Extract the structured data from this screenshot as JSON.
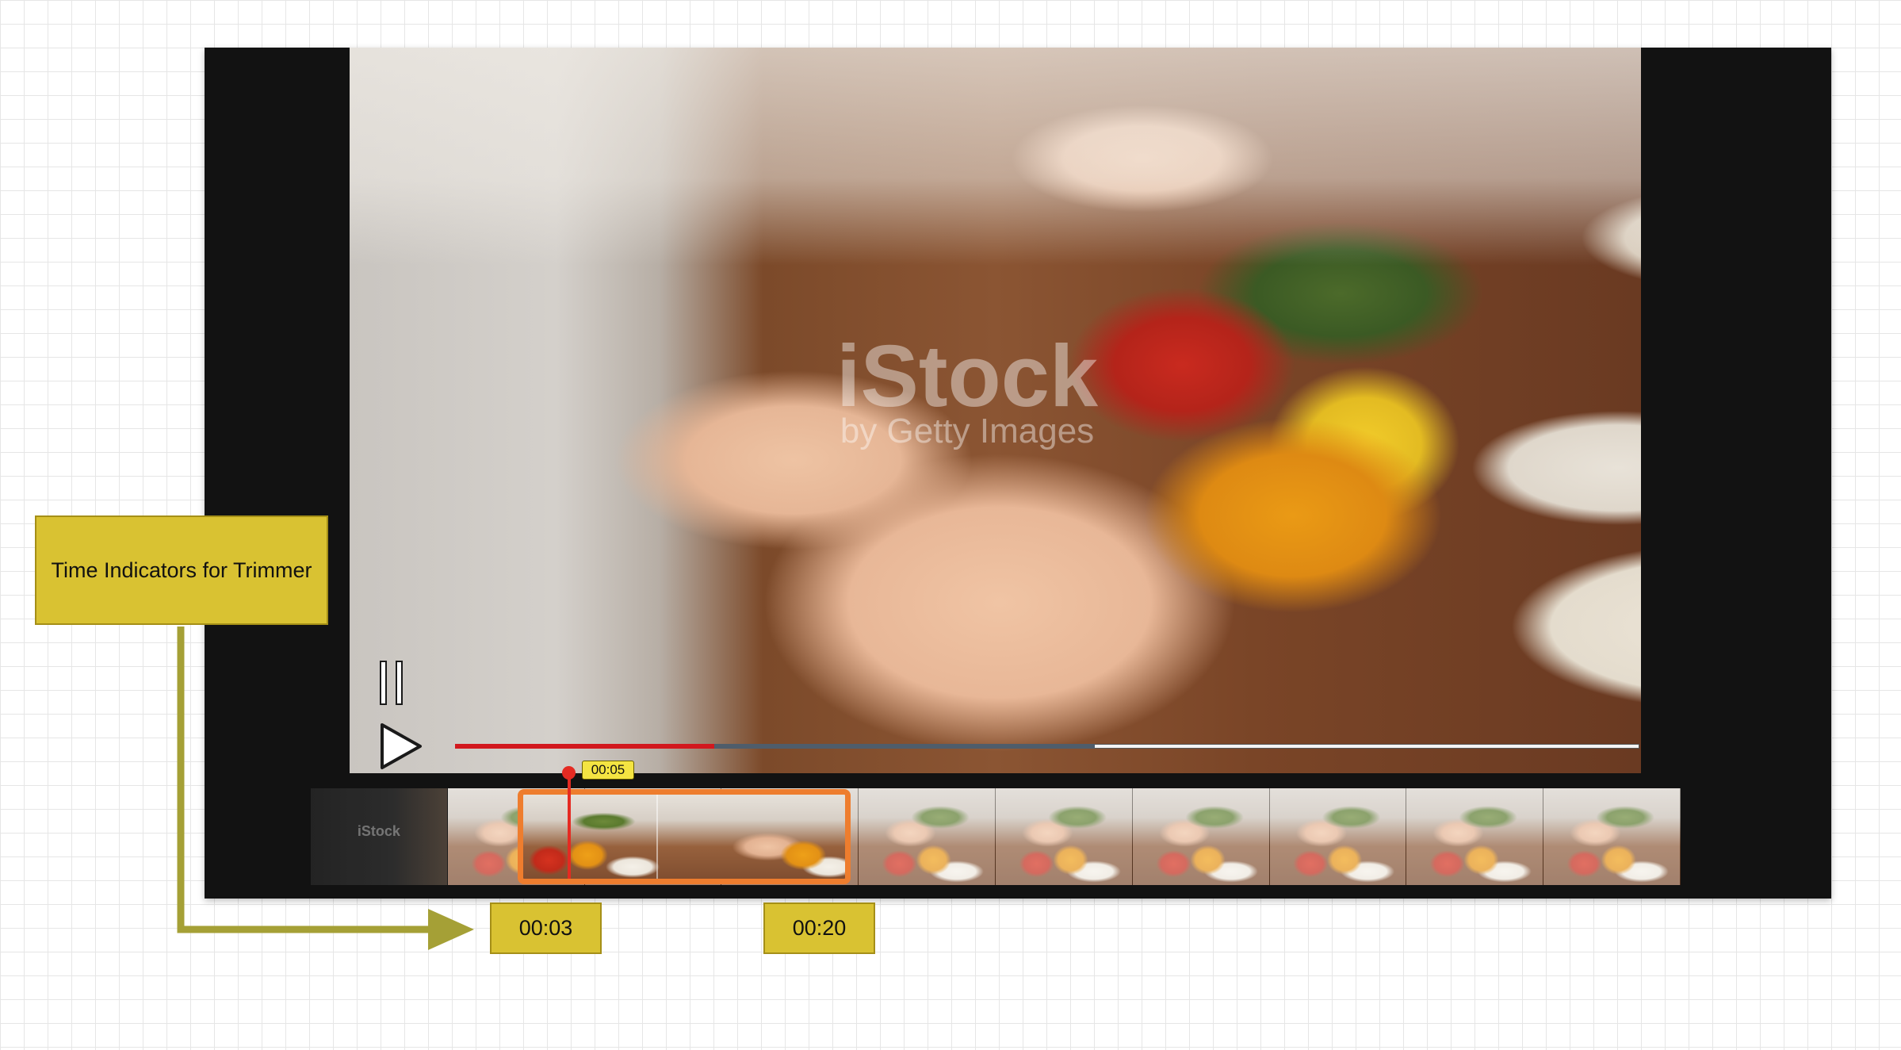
{
  "video": {
    "watermark_brand": "iStock",
    "watermark_sub": "by Getty Images",
    "progress": {
      "played_fraction": 0.219,
      "buffered_fraction": 0.54
    }
  },
  "trimmer": {
    "first_frame_label": "iStock",
    "frame_count": 10,
    "playhead_time": "00:05",
    "start_time": "00:03",
    "end_time": "00:20",
    "selection_color": "#ee7d2e",
    "playhead_color": "#e52a22"
  },
  "annotation": {
    "label": "Time Indicators for Trimmer",
    "note_color": "#d9c232",
    "arrow_color": "#a5a036"
  },
  "icons": {
    "pause": "pause-icon",
    "play": "play-icon"
  }
}
